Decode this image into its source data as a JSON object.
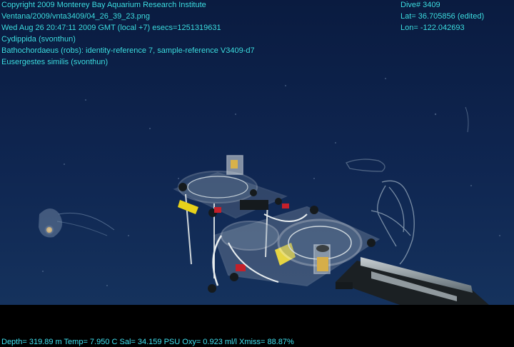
{
  "overlay": {
    "header_lines": [
      "Copyright 2009 Monterey Bay Aquarium Research Institute",
      "Ventana/2009/vnta3409/04_26_39_23.png",
      "Wed Aug 26 20:47:11 2009 GMT (local +7)  esecs=1251319631",
      "Cydippida (svonthun)",
      "Bathochordaeus (robs): identity-reference 7, sample-reference V3409-d7",
      "Eusergestes similis (svonthun)"
    ],
    "dive_lines": [
      "Dive# 3409",
      "Lat= 36.705856 (edited)",
      "Lon= -122.042693"
    ],
    "footer_line": "Depth= 319.89 m  Temp= 7.950 C  Sal= 34.159 PSU  Oxy= 0.923 ml/l  Xmiss= 88.87%"
  },
  "colors": {
    "overlay_text": "#3fe3f2",
    "water_top": "#0b1d44",
    "water_bottom": "#13305a",
    "letterbox": "#000000",
    "label_yellow": "#e8d21a",
    "valve_red": "#c4202a"
  }
}
